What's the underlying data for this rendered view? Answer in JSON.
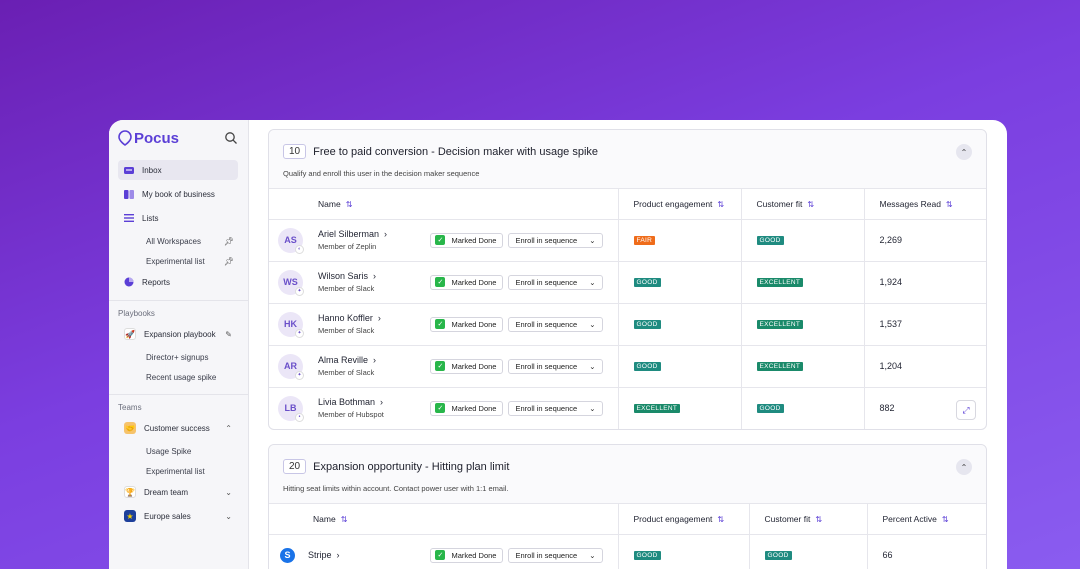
{
  "app": {
    "name": "Pocus"
  },
  "sidebar": {
    "items": [
      {
        "label": "Inbox"
      },
      {
        "label": "My book of business"
      },
      {
        "label": "Lists"
      }
    ],
    "lists": [
      {
        "label": "All Workspaces"
      },
      {
        "label": "Experimental list"
      }
    ],
    "reports_label": "Reports",
    "playbooks_section": "Playbooks",
    "playbook": {
      "label": "Expansion playbook"
    },
    "playbook_children": [
      {
        "label": "Director+ signups"
      },
      {
        "label": "Recent usage spike"
      }
    ],
    "teams_section": "Teams",
    "team_customer_success": {
      "label": "Customer success"
    },
    "team_cs_children": [
      {
        "label": "Usage Spike"
      },
      {
        "label": "Experimental list"
      }
    ],
    "team_dream": {
      "label": "Dream team"
    },
    "team_europe": {
      "label": "Europe sales"
    }
  },
  "card1": {
    "count": "10",
    "title": "Free to paid conversion - Decision maker with usage spike",
    "subtitle": "Qualify and enroll this user in the decision maker sequence",
    "columns": [
      "Name",
      "Product engagement",
      "Customer fit",
      "Messages Read"
    ],
    "rows": [
      {
        "initials": "AS",
        "name": "Ariel Silberman",
        "sub": "Member of Zeplin",
        "engagement": "FAIR",
        "fit": "GOOD",
        "metric": "2,269"
      },
      {
        "initials": "WS",
        "name": "Wilson Saris",
        "sub": "Member of Slack",
        "engagement": "GOOD",
        "fit": "EXCELLENT",
        "metric": "1,924"
      },
      {
        "initials": "HK",
        "name": "Hanno Koffler",
        "sub": "Member of Slack",
        "engagement": "GOOD",
        "fit": "EXCELLENT",
        "metric": "1,537"
      },
      {
        "initials": "AR",
        "name": "Alma Reville",
        "sub": "Member of Slack",
        "engagement": "GOOD",
        "fit": "EXCELLENT",
        "metric": "1,204"
      },
      {
        "initials": "LB",
        "name": "Livia Bothman",
        "sub": "Member of Hubspot",
        "engagement": "EXCELLENT",
        "fit": "GOOD",
        "metric": "882"
      }
    ]
  },
  "card2": {
    "count": "20",
    "title": "Expansion opportunity - Hitting plan limit",
    "subtitle": "Hitting seat limits within account. Contact power user with 1:1 email.",
    "columns": [
      "Name",
      "Product engagement",
      "Customer fit",
      "Percent Active"
    ],
    "rows": [
      {
        "name": "Stripe",
        "engagement": "GOOD",
        "fit": "GOOD",
        "metric": "66"
      }
    ]
  },
  "actions": {
    "marked_done": "Marked Done",
    "enroll": "Enroll in sequence"
  },
  "colors": {
    "accent": "#5b3fd6",
    "fair": "#ef6c1a",
    "good": "#1f8b80",
    "excellent": "#1a8a6a"
  }
}
